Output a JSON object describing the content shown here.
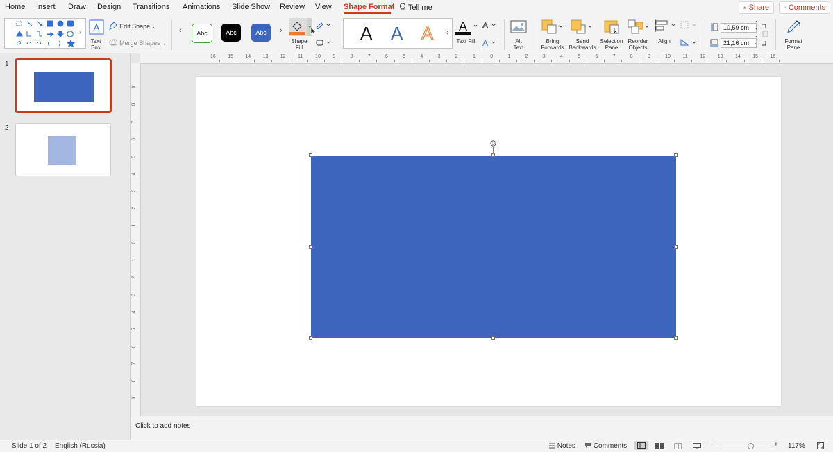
{
  "menu": {
    "tabs": [
      "Home",
      "Insert",
      "Draw",
      "Design",
      "Transitions",
      "Animations",
      "Slide Show",
      "Review",
      "View",
      "Shape Format"
    ],
    "active_tab": "Shape Format",
    "tell_me": "Tell me",
    "share": "Share",
    "comments": "Comments"
  },
  "ribbon": {
    "text_box": "Text\nBox",
    "text_box_line1": "Text",
    "text_box_line2": "Box",
    "edit_shape": "Edit Shape",
    "merge_shapes": "Merge Shapes",
    "style_samples": [
      "Abc",
      "Abc",
      "Abc"
    ],
    "shape_fill_line1": "Shape",
    "shape_fill_line2": "Fill",
    "wordart_samples": [
      "A",
      "A",
      "A"
    ],
    "text_fill": "Text Fill",
    "alt_text_line1": "Alt",
    "alt_text_line2": "Text",
    "bring_forwards_line1": "Bring",
    "bring_forwards_line2": "Forwards",
    "send_backwards_line1": "Send",
    "send_backwards_line2": "Backwards",
    "selection_pane_line1": "Selection",
    "selection_pane_line2": "Pane",
    "reorder_objects_line1": "Reorder",
    "reorder_objects_line2": "Objects",
    "align": "Align",
    "height_value": "10,59 cm",
    "width_value": "21,16 cm",
    "format_pane_line1": "Format",
    "format_pane_line2": "Pane"
  },
  "slides": {
    "numbers": [
      "1",
      "2"
    ]
  },
  "ruler": {
    "h_labels": [
      "16",
      "15",
      "14",
      "13",
      "12",
      "11",
      "10",
      "9",
      "8",
      "7",
      "6",
      "5",
      "4",
      "3",
      "2",
      "1",
      "0",
      "1",
      "2",
      "3",
      "4",
      "5",
      "6",
      "7",
      "8",
      "9",
      "10",
      "11",
      "12",
      "13",
      "14",
      "15",
      "16"
    ],
    "v_labels": [
      "9",
      "8",
      "7",
      "6",
      "5",
      "4",
      "3",
      "2",
      "1",
      "0",
      "1",
      "2",
      "3",
      "4",
      "5",
      "6",
      "7",
      "8",
      "9"
    ]
  },
  "notes": {
    "placeholder": "Click to add notes"
  },
  "status": {
    "slide_of": "Slide 1 of 2",
    "language": "English (Russia)",
    "notes": "Notes",
    "comments": "Comments",
    "zoom": "117%",
    "zoom_fraction": 0.62
  },
  "colors": {
    "accent": "#c43e1c",
    "shape_blue": "#3d65bd",
    "shape_light_blue": "#a2b7e2",
    "fill_orange": "#ed7d31"
  }
}
